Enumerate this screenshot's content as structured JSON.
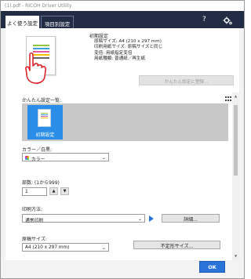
{
  "window": {
    "title": "(1).pdf - RICOH Driver Utility"
  },
  "tabs": [
    {
      "label": "よく使う設定"
    },
    {
      "label": "項目別設定"
    }
  ],
  "header": {
    "help_icon": "question-icon",
    "settings_icon": "gear-icon"
  },
  "current_preset": {
    "title": "初期設定",
    "specs": [
      "原稿サイズ: A4 (210 x 297 mm)",
      "印刷用紙サイズ: 原稿サイズと同じ",
      "変倍: 用紙指定変倍",
      "用紙種類: 普通紙／再生紙"
    ],
    "register_button": "かんたん設定に登録..."
  },
  "preset_list": {
    "label": "かんたん設定一覧:",
    "items": [
      {
        "label": "初期設定",
        "selected": true
      }
    ]
  },
  "color": {
    "label": "カラー／白黒:",
    "value": "カラー"
  },
  "copies": {
    "label": "部数: (1から999)",
    "value": "1",
    "up": "▲",
    "down": "▼"
  },
  "print_method": {
    "label": "印刷方法:",
    "value": "通常印刷",
    "details_button": "詳細..."
  },
  "original_size": {
    "label": "原稿サイズ:",
    "value": "A4 (210 x 297 mm)",
    "custom_button": "不定形サイズ..."
  },
  "footer": {
    "ok_label": "OK"
  },
  "colors": {
    "header_bg": "#222c45",
    "accent": "#2a8ee8",
    "ok_button": "#2a73d9"
  }
}
